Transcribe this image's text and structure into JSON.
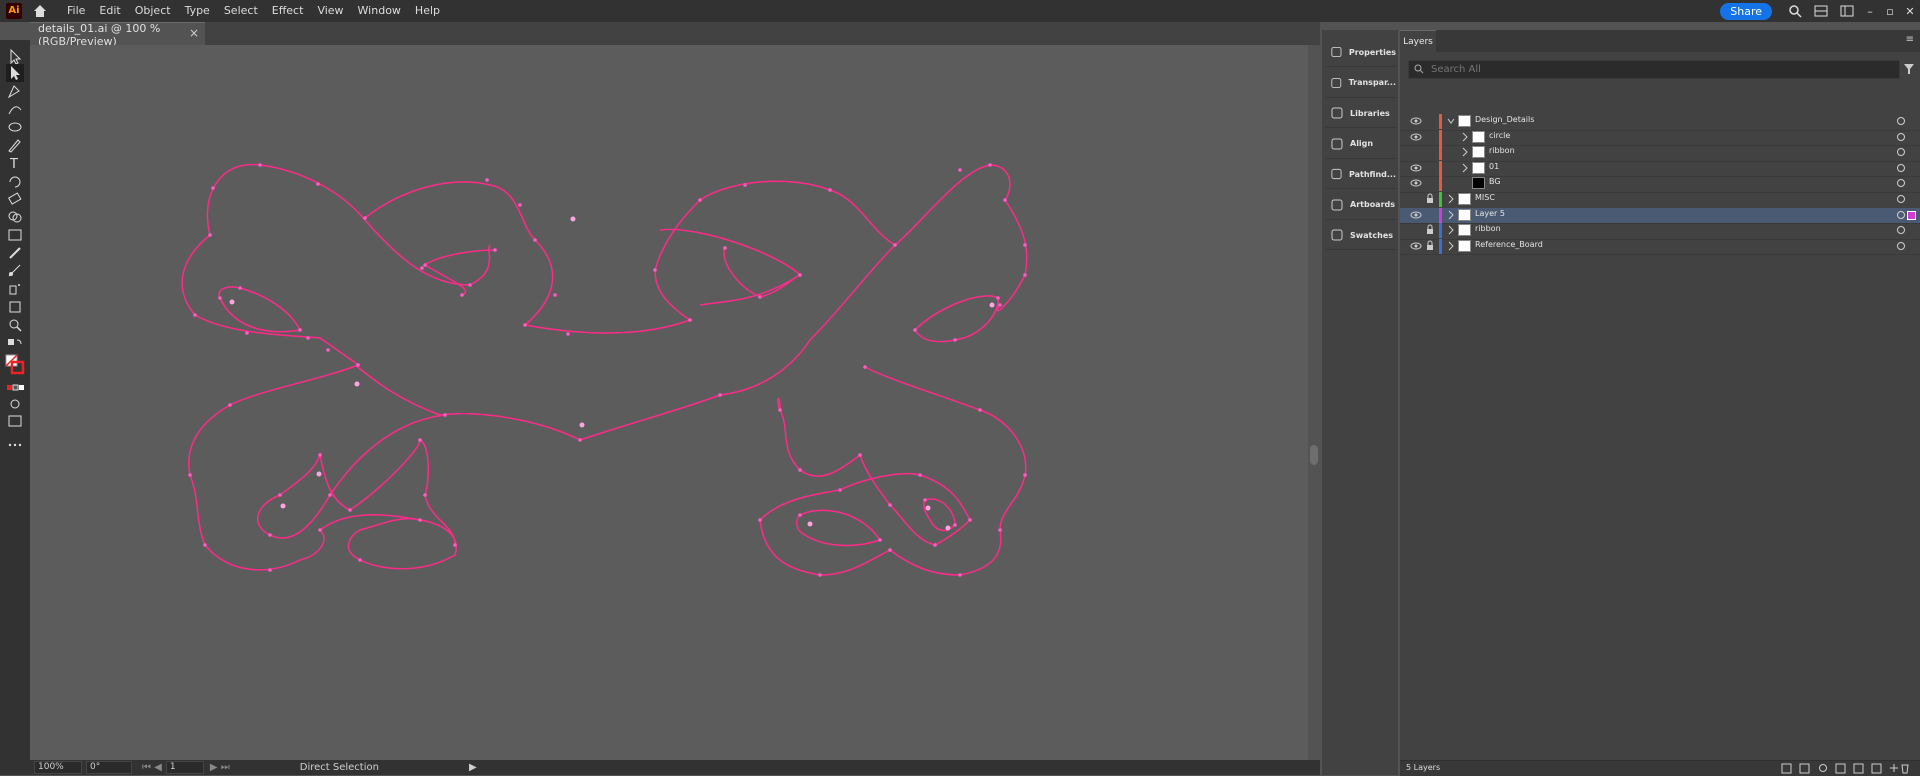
{
  "app": {
    "logo": "Ai"
  },
  "menu": [
    "File",
    "Edit",
    "Object",
    "Type",
    "Select",
    "Effect",
    "View",
    "Window",
    "Help"
  ],
  "topbar": {
    "share_label": "Share"
  },
  "document": {
    "tab_title": "details_01.ai @ 100 % (RGB/Preview)"
  },
  "status": {
    "zoom": "100%",
    "rotation": "0°",
    "artboard": "1",
    "tool": "Direct Selection"
  },
  "dock": [
    {
      "label": "Properties",
      "icon": "properties-icon"
    },
    {
      "label": "Transpar...",
      "icon": "transparency-icon"
    },
    {
      "label": "Libraries",
      "icon": "libraries-icon"
    },
    {
      "label": "Align",
      "icon": "align-icon"
    },
    {
      "label": "Pathfind...",
      "icon": "pathfinder-icon"
    },
    {
      "label": "Artboards",
      "icon": "artboards-icon"
    },
    {
      "label": "Swatches",
      "icon": "swatches-icon"
    }
  ],
  "layers": {
    "tab": "Layers",
    "search_placeholder": "Search All",
    "rows": [
      {
        "name": "Design_Details",
        "color": "#e05b3f",
        "visible": true,
        "locked": false,
        "level": 0,
        "expanded": true
      },
      {
        "name": "circle",
        "color": "#e05b3f",
        "visible": true,
        "locked": false,
        "level": 1
      },
      {
        "name": "ribbon",
        "color": "#e05b3f",
        "visible": false,
        "locked": false,
        "level": 1
      },
      {
        "name": "01",
        "color": "#e05b3f",
        "visible": true,
        "locked": false,
        "level": 1
      },
      {
        "name": "BG",
        "color": "#e05b3f",
        "visible": true,
        "locked": false,
        "level": 1,
        "no_twirl": true
      },
      {
        "name": "MISC",
        "color": "#3cc23c",
        "visible": false,
        "locked": true,
        "level": 0
      },
      {
        "name": "Layer 5",
        "color": "#d23cd2",
        "visible": true,
        "locked": false,
        "level": 0,
        "selected": true
      },
      {
        "name": "ribbon",
        "color": "#3c6fd2",
        "visible": false,
        "locked": true,
        "level": 0
      },
      {
        "name": "Reference_Board",
        "color": "#3c6fd2",
        "visible": true,
        "locked": true,
        "level": 0
      }
    ],
    "footer": "5 Layers"
  },
  "colors": {
    "path_stroke": "#ff2a8a",
    "anchor": "#ff5cc4",
    "accent": "#1473e6"
  }
}
